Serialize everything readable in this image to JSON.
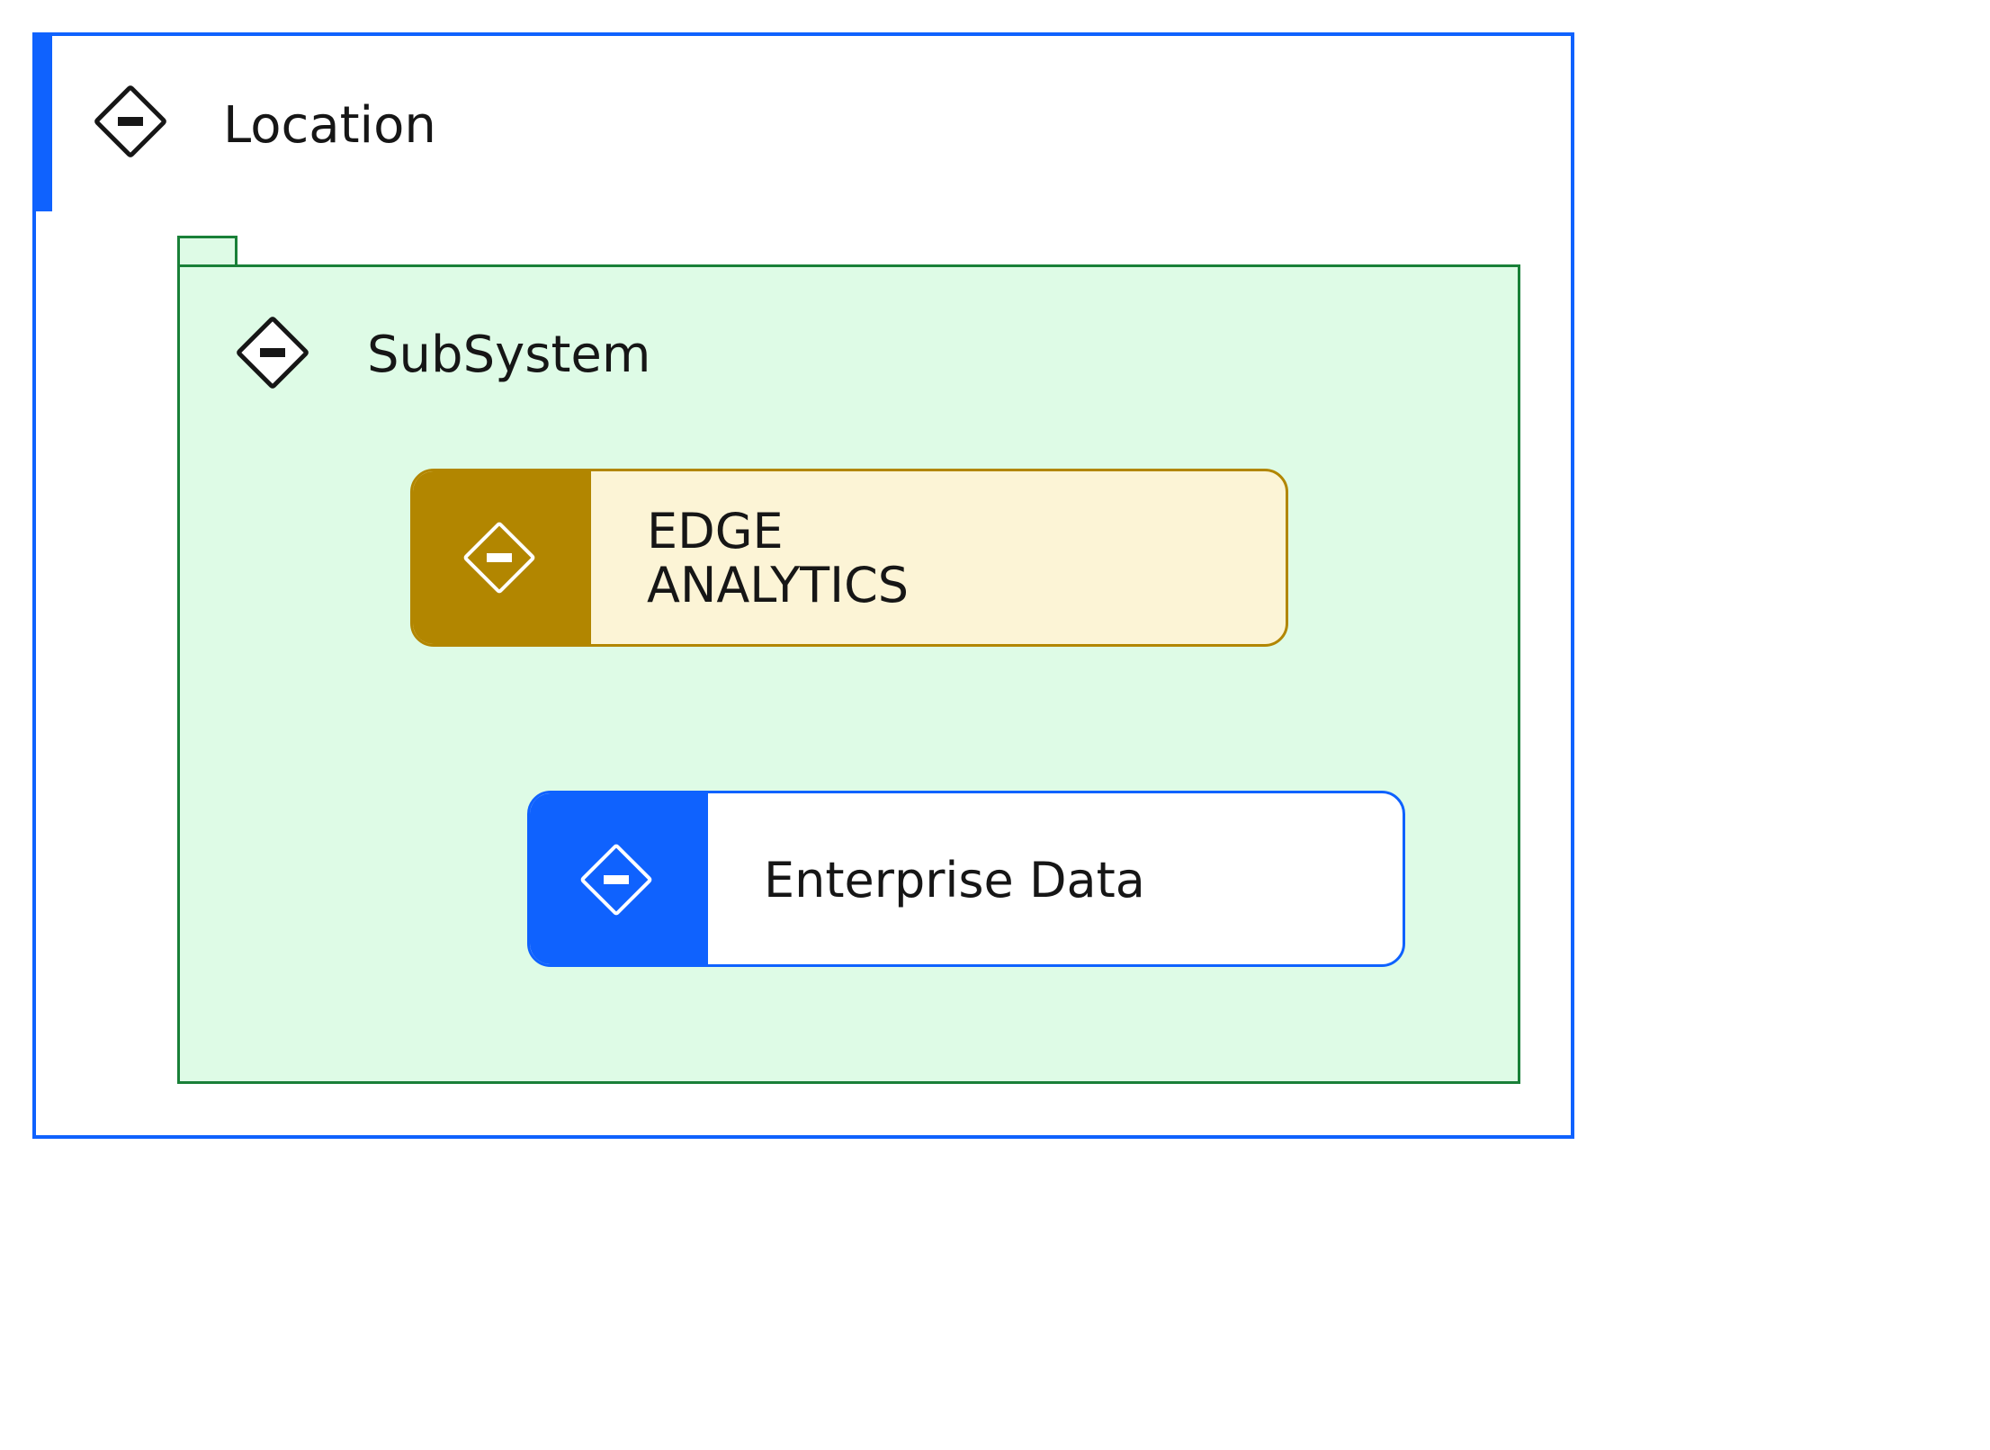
{
  "diagram": {
    "location": {
      "label": "Location",
      "icon": "location-icon",
      "border_color": "#0f62fe"
    },
    "subsystem": {
      "label": "SubSystem",
      "icon": "subsystem-icon",
      "border_color": "#198038",
      "fill_color": "#defbe6"
    },
    "nodes": [
      {
        "line1": "EDGE",
        "line2": "ANALYTICS",
        "icon": "edge-analytics-icon",
        "accent_color": "#b28600",
        "fill_color": "#fcf4d6"
      },
      {
        "label": "Enterprise Data",
        "icon": "enterprise-data-icon",
        "accent_color": "#0f62fe",
        "fill_color": "#ffffff"
      }
    ]
  }
}
